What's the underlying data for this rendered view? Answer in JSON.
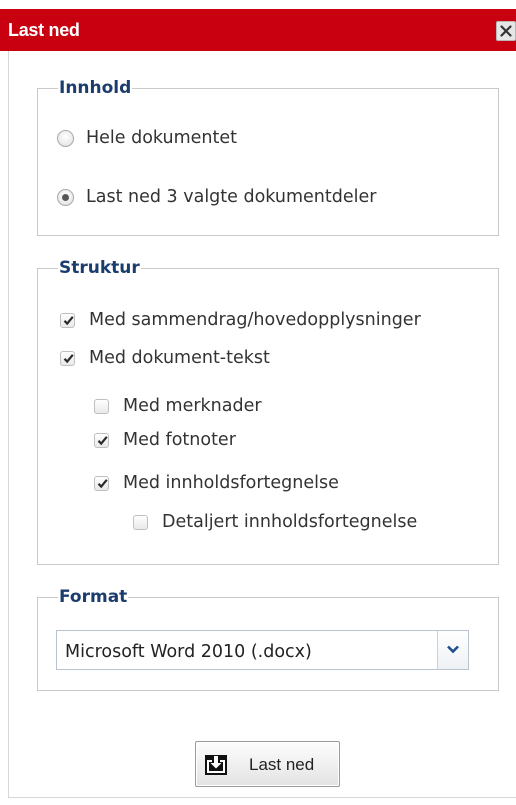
{
  "dialog": {
    "title": "Last ned",
    "close_icon": "close-icon"
  },
  "innhold": {
    "legend": "Innhold",
    "options": [
      {
        "label": "Hele dokumentet",
        "checked": false
      },
      {
        "label": "Last ned 3 valgte dokumentdeler",
        "checked": true
      }
    ]
  },
  "struktur": {
    "legend": "Struktur",
    "items": [
      {
        "label": "Med sammendrag/hovedopplysninger",
        "checked": true
      },
      {
        "label": "Med dokument-tekst",
        "checked": true
      },
      {
        "label": "Med merknader",
        "checked": false
      },
      {
        "label": "Med fotnoter",
        "checked": true
      },
      {
        "label": "Med innholdsfortegnelse",
        "checked": true
      },
      {
        "label": "Detaljert innholdsfortegnelse",
        "checked": false
      }
    ]
  },
  "format": {
    "legend": "Format",
    "selected": "Microsoft Word 2010 (.docx)",
    "dropdown_icon": "chevron-down-icon"
  },
  "download": {
    "label": "Last ned",
    "icon": "download-icon"
  },
  "colors": {
    "titlebar": "#c8000f",
    "legend": "#1a3d6e"
  }
}
